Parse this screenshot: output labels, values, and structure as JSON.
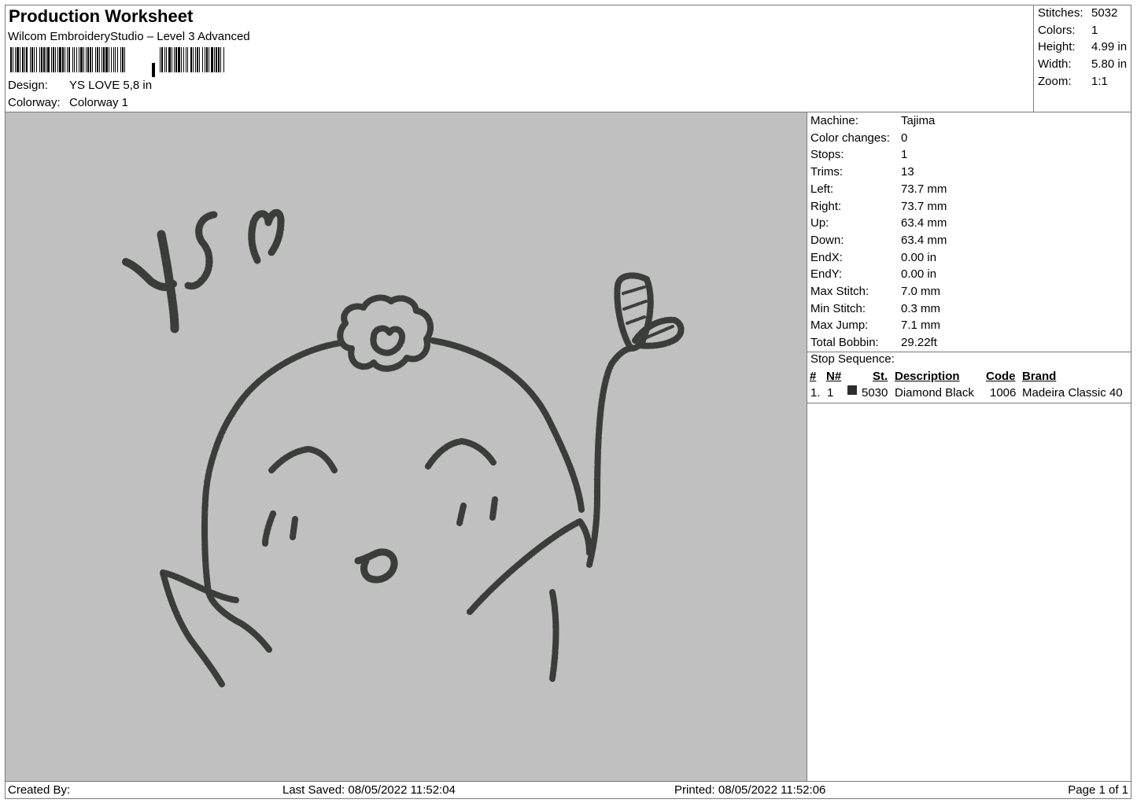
{
  "header": {
    "title": "Production Worksheet",
    "software": "Wilcom EmbroideryStudio – Level 3 Advanced",
    "design_label": "Design:",
    "design_value": "YS LOVE 5,8 in",
    "colorway_label": "Colorway:",
    "colorway_value": "Colorway 1"
  },
  "stats": {
    "stitches_label": "Stitches:",
    "stitches_value": "5032",
    "colors_label": "Colors:",
    "colors_value": "1",
    "height_label": "Height:",
    "height_value": "4.99 in",
    "width_label": "Width:",
    "width_value": "5.80 in",
    "zoom_label": "Zoom:",
    "zoom_value": "1:1"
  },
  "machine_info": [
    {
      "label": "Machine:",
      "value": "Tajima"
    },
    {
      "label": "Color changes:",
      "value": "0"
    },
    {
      "label": "Stops:",
      "value": "1"
    },
    {
      "label": "Trims:",
      "value": "13"
    },
    {
      "label": "Left:",
      "value": "73.7 mm"
    },
    {
      "label": "Right:",
      "value": "73.7 mm"
    },
    {
      "label": "Up:",
      "value": "63.4 mm"
    },
    {
      "label": "Down:",
      "value": "63.4 mm"
    },
    {
      "label": "EndX:",
      "value": "0.00 in"
    },
    {
      "label": "EndY:",
      "value": "0.00 in"
    },
    {
      "label": "Max Stitch:",
      "value": "7.0 mm"
    },
    {
      "label": "Min Stitch:",
      "value": "0.3 mm"
    },
    {
      "label": "Max Jump:",
      "value": "7.1 mm"
    },
    {
      "label": "Total Bobbin:",
      "value": "29.22ft"
    }
  ],
  "stop_sequence": {
    "title": "Stop Sequence:",
    "columns": {
      "num": "#",
      "n": "N#",
      "st": "St.",
      "description": "Description",
      "code": "Code",
      "brand": "Brand"
    },
    "rows": [
      {
        "num": "1.",
        "n": "1",
        "color": "#2d2d2d",
        "st": "5030",
        "description": "Diamond Black",
        "code": "1006",
        "brand": "Madeira Classic 40"
      }
    ]
  },
  "footer": {
    "created_by": "Created By:",
    "last_saved": "Last Saved: 08/05/2022 11:52:04",
    "printed": "Printed: 08/05/2022 11:52:06",
    "page": "Page 1 of 1"
  },
  "colors": {
    "canvas_background": "#c0c0c0",
    "thread": "#3a3d3a"
  }
}
